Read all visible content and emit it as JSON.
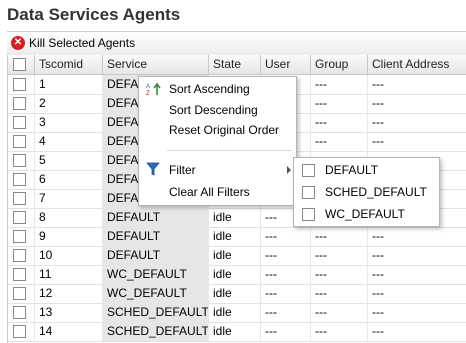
{
  "page": {
    "title": "Data Services Agents"
  },
  "toolbar": {
    "kill_label": "Kill Selected Agents"
  },
  "table": {
    "columns": [
      "Tscomid",
      "Service",
      "State",
      "User",
      "Group",
      "Client Address"
    ],
    "rows": [
      [
        "1",
        "DEFAULT",
        "",
        "",
        "---",
        "---"
      ],
      [
        "2",
        "DEFAULT",
        "",
        "",
        "---",
        "---"
      ],
      [
        "3",
        "DEFAULT",
        "",
        "",
        "---",
        "---"
      ],
      [
        "4",
        "DEFAULT",
        "",
        "",
        "---",
        "---"
      ],
      [
        "5",
        "DEFAULT",
        "",
        "",
        "---",
        "---"
      ],
      [
        "6",
        "DEFAULT",
        "",
        "",
        "---",
        "---"
      ],
      [
        "7",
        "DEFAULT",
        "",
        "",
        "---",
        "---"
      ],
      [
        "8",
        "DEFAULT",
        "idle",
        "---",
        "---",
        "---"
      ],
      [
        "9",
        "DEFAULT",
        "idle",
        "---",
        "---",
        "---"
      ],
      [
        "10",
        "DEFAULT",
        "idle",
        "---",
        "---",
        "---"
      ],
      [
        "11",
        "WC_DEFAULT",
        "idle",
        "---",
        "---",
        "---"
      ],
      [
        "12",
        "WC_DEFAULT",
        "idle",
        "---",
        "---",
        "---"
      ],
      [
        "13",
        "SCHED_DEFAULT",
        "idle",
        "---",
        "---",
        "---"
      ],
      [
        "14",
        "SCHED_DEFAULT",
        "idle",
        "---",
        "---",
        "---"
      ]
    ]
  },
  "context_menu": {
    "sort_ascending": "Sort Ascending",
    "sort_descending": "Sort Descending",
    "reset_order": "Reset Original Order",
    "filter": "Filter",
    "clear_filters": "Clear All Filters"
  },
  "filter_submenu": {
    "options": [
      "DEFAULT",
      "SCHED_DEFAULT",
      "WC_DEFAULT"
    ]
  },
  "colors": {
    "kill_icon": "#d42020",
    "filter_icon": "#2b6cc4"
  }
}
